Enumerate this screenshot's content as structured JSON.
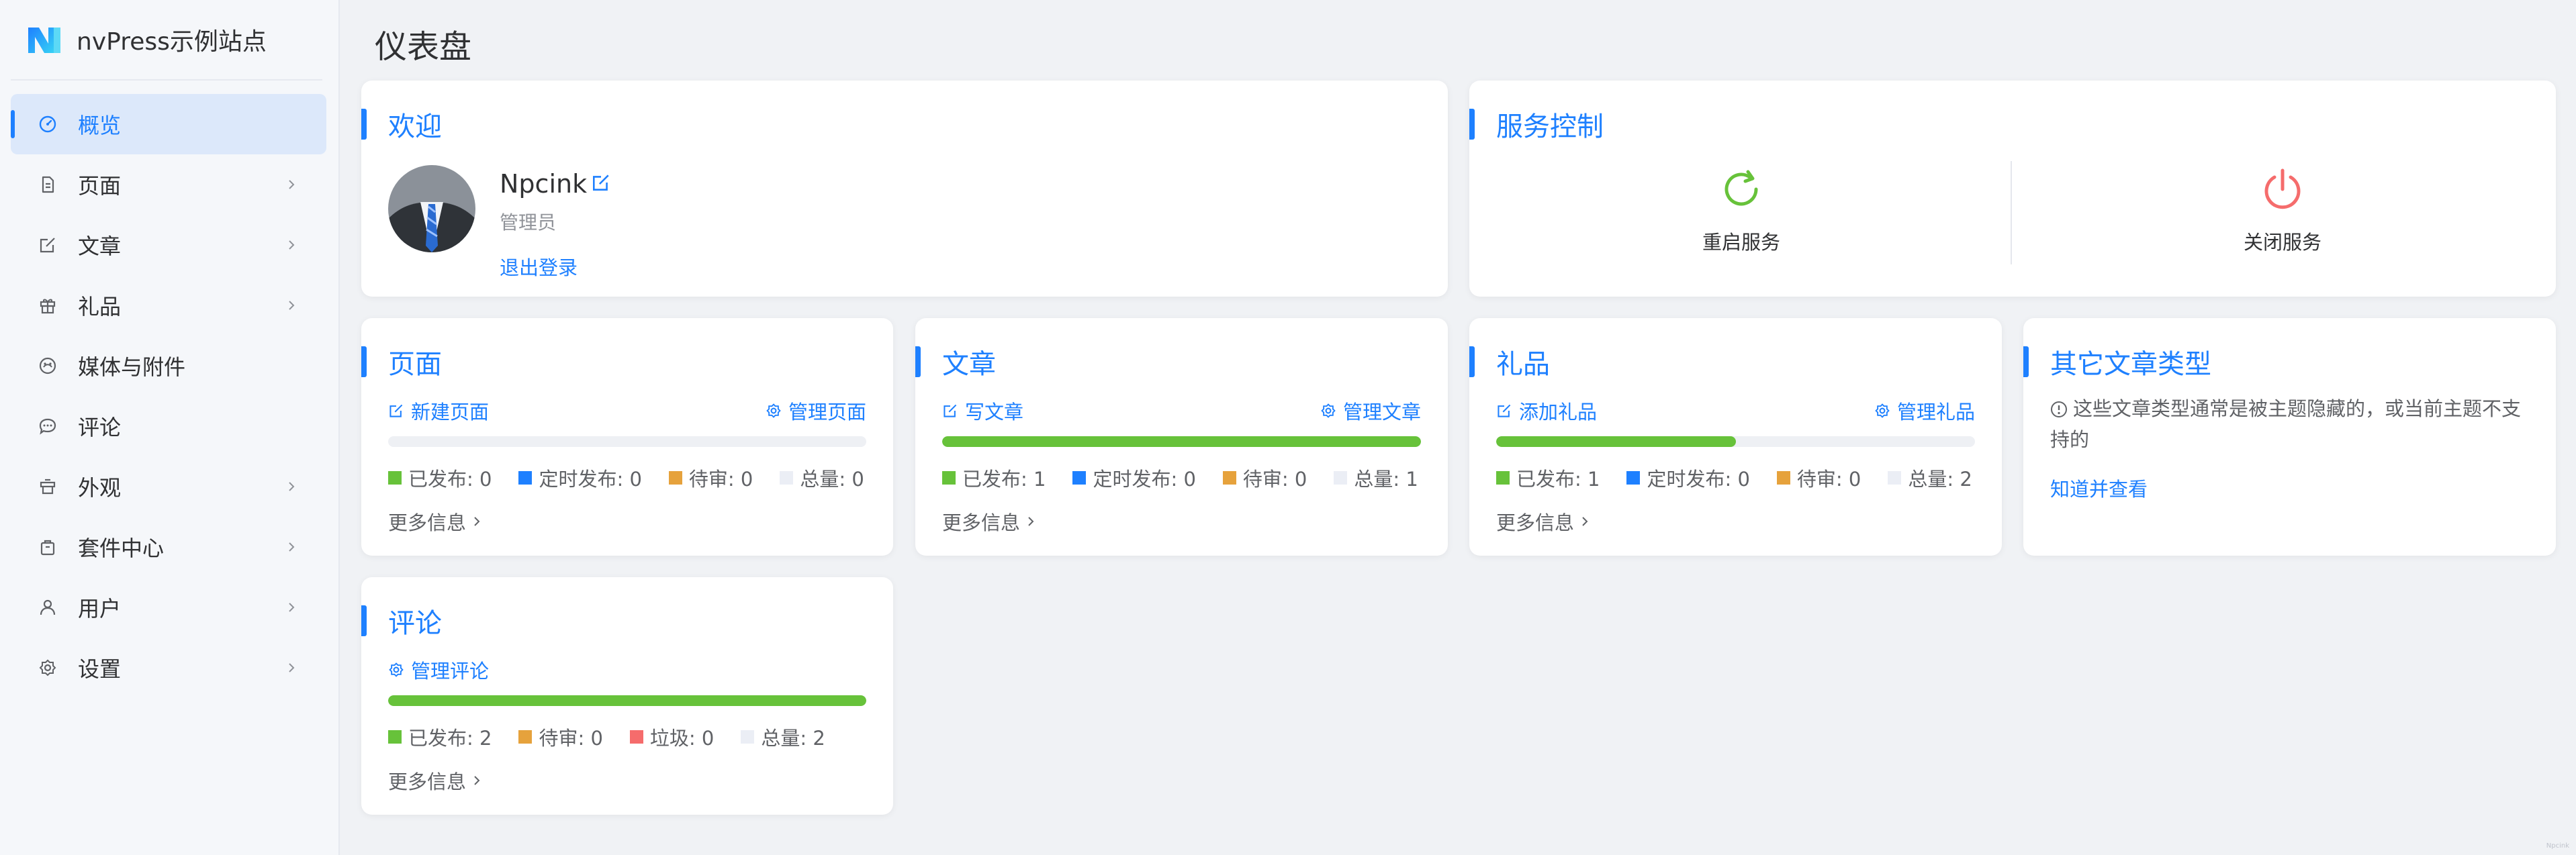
{
  "brand": {
    "name": "nvPress示例站点"
  },
  "sidebar": {
    "items": [
      {
        "label": "概览",
        "icon": "dashboard-icon",
        "active": true
      },
      {
        "label": "页面",
        "icon": "page-icon"
      },
      {
        "label": "文章",
        "icon": "edit-icon"
      },
      {
        "label": "礼品",
        "icon": "gift-icon"
      },
      {
        "label": "媒体与附件",
        "icon": "media-icon"
      },
      {
        "label": "评论",
        "icon": "comment-icon"
      },
      {
        "label": "外观",
        "icon": "appearance-icon"
      },
      {
        "label": "套件中心",
        "icon": "package-icon"
      },
      {
        "label": "用户",
        "icon": "user-icon"
      },
      {
        "label": "设置",
        "icon": "settings-icon"
      }
    ]
  },
  "page": {
    "title": "仪表盘"
  },
  "welcome": {
    "title": "欢迎",
    "user_name": "Npcink",
    "role": "管理员",
    "logout": "退出登录"
  },
  "service": {
    "title": "服务控制",
    "restart": "重启服务",
    "shutdown": "关闭服务"
  },
  "pages_card": {
    "title": "页面",
    "action_left": "新建页面",
    "action_right": "管理页面",
    "published_ratio": 0,
    "stats": {
      "published": "已发布: 0",
      "scheduled": "定时发布: 0",
      "pending": "待审: 0",
      "total": "总量: 0"
    },
    "more": "更多信息"
  },
  "posts_card": {
    "title": "文章",
    "action_left": "写文章",
    "action_right": "管理文章",
    "published_ratio": 1,
    "stats": {
      "published": "已发布: 1",
      "scheduled": "定时发布: 0",
      "pending": "待审: 0",
      "total": "总量: 1"
    },
    "more": "更多信息"
  },
  "gifts_card": {
    "title": "礼品",
    "action_left": "添加礼品",
    "action_right": "管理礼品",
    "published_ratio": 0.5,
    "stats": {
      "published": "已发布: 1",
      "scheduled": "定时发布: 0",
      "pending": "待审: 0",
      "total": "总量: 2"
    },
    "more": "更多信息"
  },
  "other_card": {
    "title": "其它文章类型",
    "note": "这些文章类型通常是被主题隐藏的，或当前主题不支持的",
    "link": "知道并查看"
  },
  "comments_card": {
    "title": "评论",
    "action": "管理评论",
    "approved_ratio": 1,
    "stats": {
      "published": "已发布: 2",
      "pending": "待审: 0",
      "spam": "垃圾: 0",
      "total": "总量: 2"
    },
    "more": "更多信息"
  },
  "colors": {
    "accent": "#1e80ff",
    "published": "#67c23a",
    "scheduled": "#1e80ff",
    "pending": "#e6a23c",
    "spam": "#f56c6c",
    "total": "#ebeef5"
  },
  "watermark": "Npcink"
}
